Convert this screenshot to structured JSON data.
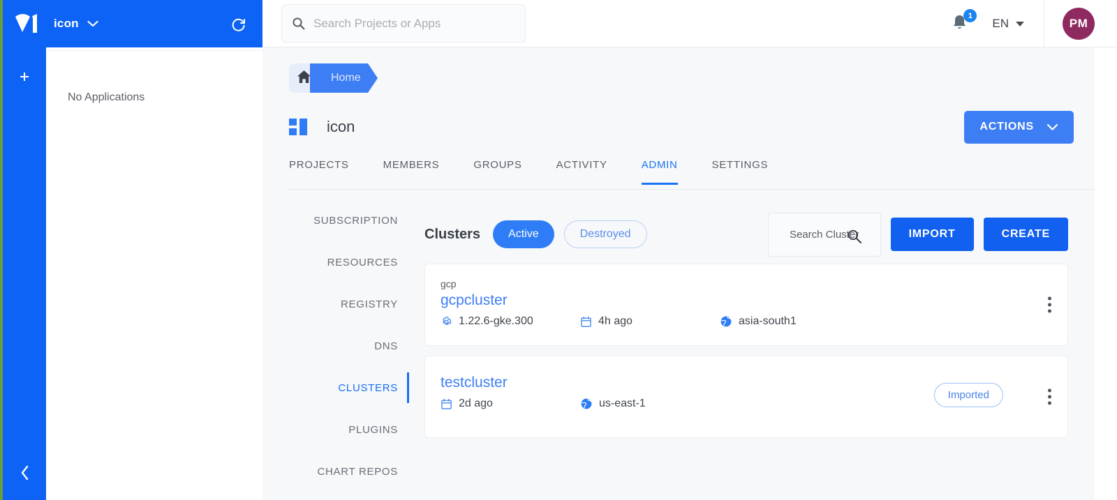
{
  "brand": {
    "logo": "opsera-logo",
    "org_name": "icon"
  },
  "rail": {
    "add_label": "+",
    "add_icon": "plus-icon",
    "collapse_icon": "chevron-left-icon"
  },
  "apps_panel": {
    "empty_text": "No Applications",
    "refresh_icon": "refresh-icon"
  },
  "topbar": {
    "search": {
      "placeholder": "Search Projects or Apps",
      "value": "",
      "icon": "search-icon"
    },
    "notifications": {
      "icon": "bell-icon",
      "count": "1"
    },
    "language": {
      "value": "EN",
      "icon": "chevron-down-icon"
    },
    "avatar": {
      "initials": "PM"
    }
  },
  "breadcrumb": {
    "home_icon": "home-icon",
    "current": "Home"
  },
  "page": {
    "icon": "dashboard-grid-icon",
    "title": "icon",
    "actions_label": "ACTIONS",
    "actions_icon": "chevron-down-icon"
  },
  "tabs": [
    {
      "label": "PROJECTS",
      "active": false
    },
    {
      "label": "MEMBERS",
      "active": false
    },
    {
      "label": "GROUPS",
      "active": false
    },
    {
      "label": "ACTIVITY",
      "active": false
    },
    {
      "label": "ADMIN",
      "active": true
    },
    {
      "label": "SETTINGS",
      "active": false
    }
  ],
  "subnav": [
    {
      "label": "SUBSCRIPTION",
      "active": false
    },
    {
      "label": "RESOURCES",
      "active": false
    },
    {
      "label": "REGISTRY",
      "active": false
    },
    {
      "label": "DNS",
      "active": false
    },
    {
      "label": "CLUSTERS",
      "active": true
    },
    {
      "label": "PLUGINS",
      "active": false
    },
    {
      "label": "CHART REPOS",
      "active": false
    }
  ],
  "clusters": {
    "heading": "Clusters",
    "filters": [
      {
        "label": "Active",
        "selected": true
      },
      {
        "label": "Destroyed",
        "selected": false
      }
    ],
    "search": {
      "placeholder": "Search Cluster",
      "value": "",
      "icon": "search-icon"
    },
    "import_label": "IMPORT",
    "create_label": "CREATE",
    "items": [
      {
        "provider": "gcp",
        "name": "gcpcluster",
        "version": "1.22.6-gke.300",
        "version_icon": "gear-icon",
        "updated": "4h ago",
        "updated_icon": "calendar-icon",
        "region": "asia-south1",
        "region_icon": "globe-icon",
        "badge": "",
        "menu_icon": "kebab-menu-icon"
      },
      {
        "provider": "",
        "name": "testcluster",
        "version": "",
        "version_icon": "",
        "updated": "2d ago",
        "updated_icon": "calendar-icon",
        "region": "us-east-1",
        "region_icon": "globe-icon",
        "badge": "Imported",
        "menu_icon": "kebab-menu-icon"
      }
    ]
  },
  "colors": {
    "brand_blue": "#0d63f5",
    "accent_blue": "#3d7ef5",
    "link_blue": "#1a73f5",
    "avatar": "#8e2a5f",
    "edge_green": "#6a9c3a",
    "canvas": "#f6f8fa"
  }
}
